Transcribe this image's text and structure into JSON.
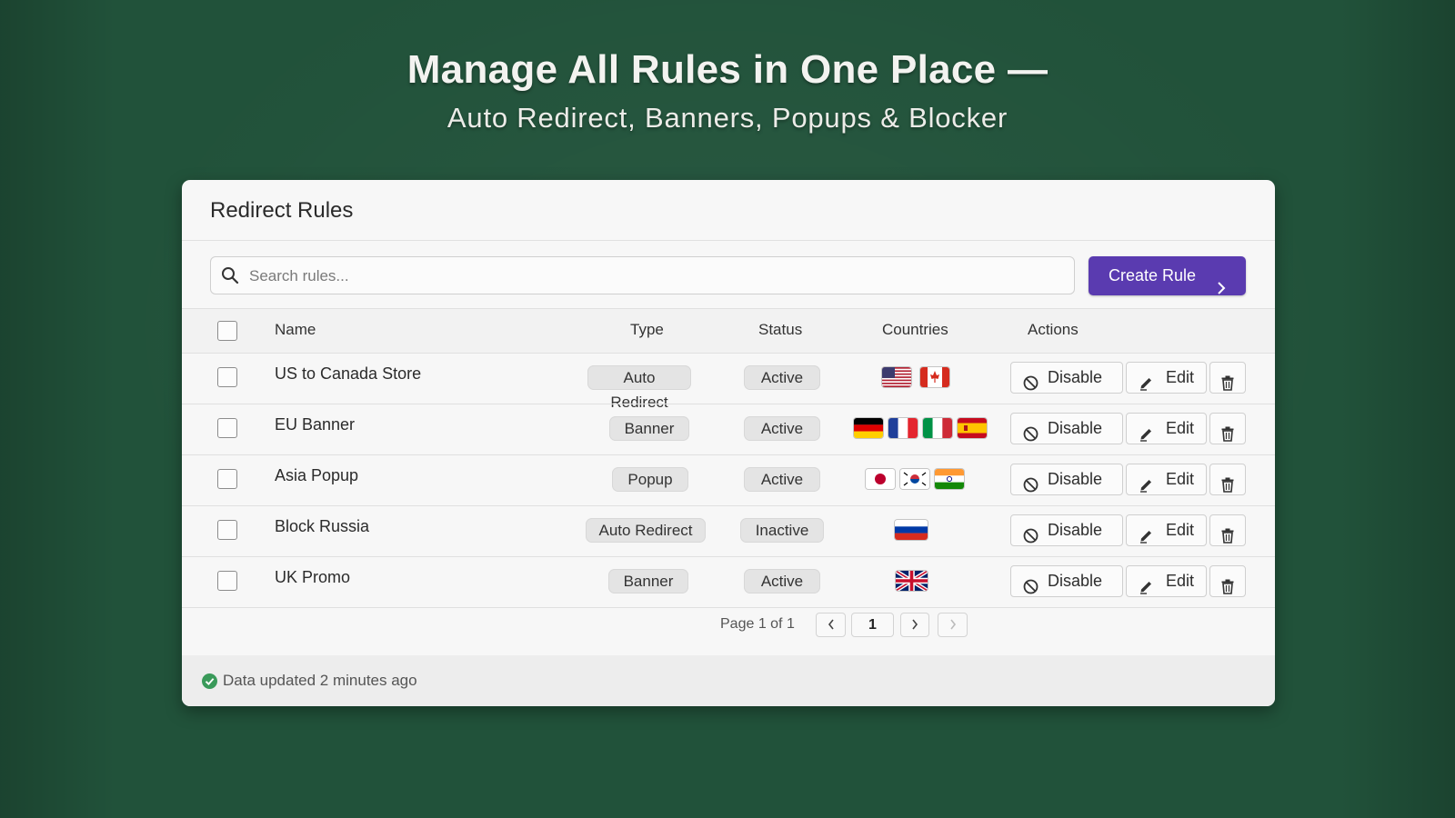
{
  "hero": {
    "title": "Manage All Rules in One Place —",
    "subtitle": "Auto Redirect, Banners, Popups & Blocker"
  },
  "card": {
    "title": "Redirect Rules",
    "search_placeholder": "Search rules...",
    "create_label": "Create Rule",
    "columns": {
      "name": "Name",
      "type": "Type",
      "status": "Status",
      "countries": "Countries",
      "actions": "Actions"
    },
    "rows": [
      {
        "name": "US to Canada Store",
        "type": "Auto Redirect",
        "status": "Active",
        "countries": [
          "us",
          "ca"
        ]
      },
      {
        "name": "EU Banner",
        "type": "Banner",
        "status": "Active",
        "countries": [
          "de",
          "fr",
          "it",
          "es"
        ]
      },
      {
        "name": "Asia Popup",
        "type": "Popup",
        "status": "Active",
        "countries": [
          "jp",
          "kr",
          "in"
        ]
      },
      {
        "name": "Block Russia",
        "type": "Auto Redirect",
        "status": "Inactive",
        "countries": [
          "ru"
        ]
      },
      {
        "name": "UK Promo",
        "type": "Banner",
        "status": "Active",
        "countries": [
          "gb"
        ]
      }
    ],
    "actions": {
      "disable": "Disable",
      "edit": "Edit"
    },
    "pager": {
      "text": "Page 1 of 1",
      "current": "1"
    },
    "footer": "Data updated 2 minutes ago"
  },
  "colors": {
    "background": "#21523a",
    "accent": "#5a3bb0",
    "success": "#3a9a5a"
  },
  "icons": [
    "search-icon",
    "chevron-right-icon",
    "ban-icon",
    "pencil-icon",
    "trash-icon",
    "check-circle-icon",
    "chevron-left-icon"
  ]
}
